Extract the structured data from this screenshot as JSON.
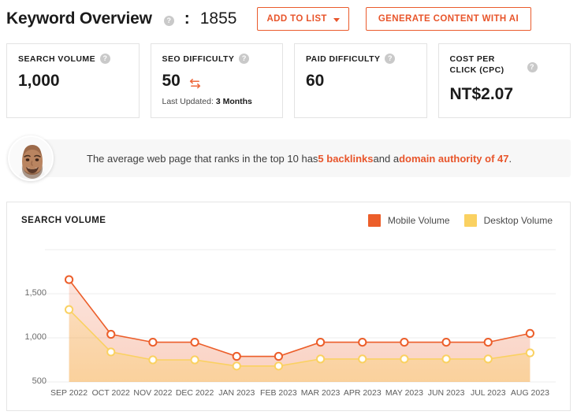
{
  "header": {
    "title": "Keyword Overview",
    "info_icon": "?",
    "separator": ":",
    "keyword_id": "1855",
    "add_to_list_label": "ADD TO LIST",
    "generate_label": "GENERATE CONTENT WITH AI"
  },
  "colors": {
    "accent": "#e8552b",
    "mobile": "#ec5e2a",
    "desktop": "#fad161",
    "border": "#e3e3e3",
    "grid": "#ececec"
  },
  "cards": [
    {
      "label": "SEARCH VOLUME",
      "info_icon": "?",
      "value": "1,000",
      "sub_prefix": "",
      "sub_value": ""
    },
    {
      "label": "SEO DIFFICULTY",
      "info_icon": "?",
      "value": "50",
      "refresh_icon": "refresh-icon",
      "sub_prefix": "Last Updated:",
      "sub_value": "3 Months"
    },
    {
      "label": "PAID DIFFICULTY",
      "info_icon": "?",
      "value": "60",
      "sub_prefix": "",
      "sub_value": ""
    },
    {
      "label": "COST PER CLICK (CPC)",
      "info_icon": "?",
      "value": "NT$2.07",
      "sub_prefix": "",
      "sub_value": ""
    }
  ],
  "insight": {
    "avatar_alt": "avatar",
    "part1": "The average web page that ranks in the top 10 has ",
    "highlight1": "5 backlinks",
    "part2": " and a ",
    "highlight2": "domain authority of 47",
    "part3": "."
  },
  "chart_panel": {
    "title": "SEARCH VOLUME",
    "legend": [
      {
        "label": "Mobile Volume",
        "color": "#ec5e2a"
      },
      {
        "label": "Desktop Volume",
        "color": "#fad161"
      }
    ]
  },
  "chart_data": {
    "type": "line",
    "title": "SEARCH VOLUME",
    "xlabel": "",
    "ylabel": "",
    "ylim": [
      500,
      2000
    ],
    "yticks": [
      500,
      1000,
      1500
    ],
    "ytick_labels": [
      "500",
      "1,000",
      "1,500"
    ],
    "grid": true,
    "legend_position": "top-right",
    "filled_area": true,
    "categories": [
      "SEP 2022",
      "OCT 2022",
      "NOV 2022",
      "DEC 2022",
      "JAN 2023",
      "FEB 2023",
      "MAR 2023",
      "APR 2023",
      "MAY 2023",
      "JUN 2023",
      "JUL 2023",
      "AUG 2023"
    ],
    "series": [
      {
        "name": "Mobile Volume",
        "color": "#ec5e2a",
        "values": [
          1660,
          1040,
          950,
          950,
          790,
          790,
          950,
          950,
          950,
          950,
          950,
          1050
        ]
      },
      {
        "name": "Desktop Volume",
        "color": "#fad161",
        "values": [
          1320,
          840,
          750,
          750,
          680,
          680,
          760,
          760,
          760,
          760,
          760,
          830
        ]
      }
    ]
  }
}
